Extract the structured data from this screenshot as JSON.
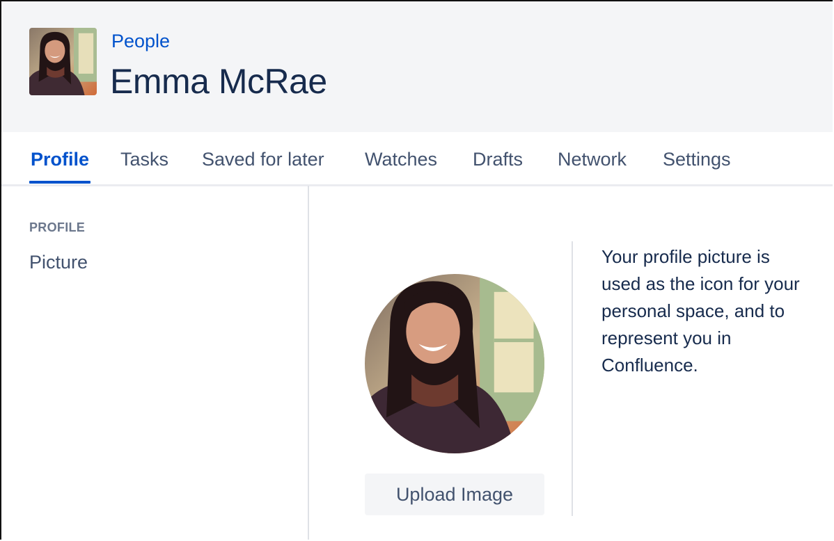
{
  "header": {
    "breadcrumb": "People",
    "name": "Emma McRae"
  },
  "tabs": [
    {
      "label": "Profile",
      "active": true
    },
    {
      "label": "Tasks",
      "active": false
    },
    {
      "label": "Saved for later",
      "active": false
    },
    {
      "label": "Watches",
      "active": false
    },
    {
      "label": "Drafts",
      "active": false
    },
    {
      "label": "Network",
      "active": false
    },
    {
      "label": "Settings",
      "active": false
    }
  ],
  "sidebar": {
    "heading": "PROFILE",
    "items": [
      {
        "label": "Picture"
      }
    ]
  },
  "main": {
    "upload_label": "Upload Image",
    "help_text": "Your profile picture is used as the icon for your personal space, and to represent you in Confluence."
  },
  "colors": {
    "accent": "#0052cc",
    "header_bg": "#f4f5f7",
    "text": "#172b4d"
  }
}
